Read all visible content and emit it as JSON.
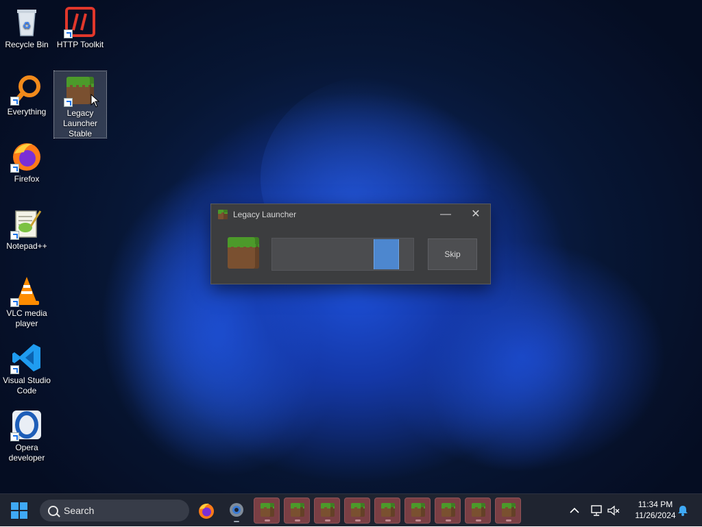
{
  "desktop": {
    "icons": [
      {
        "label": "Recycle Bin",
        "icon": "recycle-bin-icon"
      },
      {
        "label": "HTTP Toolkit",
        "icon": "http-toolkit-icon"
      },
      {
        "label": "Everything",
        "icon": "everything-search-icon"
      },
      {
        "label": "Legacy Launcher Stable",
        "icon": "grass-block-icon"
      },
      {
        "label": "Firefox",
        "icon": "firefox-icon"
      },
      {
        "label": "Notepad++",
        "icon": "notepad-plus-plus-icon"
      },
      {
        "label": "VLC media player",
        "icon": "vlc-cone-icon"
      },
      {
        "label": "Visual Studio Code",
        "icon": "vscode-icon"
      },
      {
        "label": "Opera developer",
        "icon": "opera-icon"
      }
    ]
  },
  "launcher_window": {
    "title": "Legacy Launcher",
    "skip_label": "Skip",
    "progress_segment": [
      0.72,
      0.89
    ],
    "accent_color": "#4d87cf"
  },
  "taskbar": {
    "search_label": "Search",
    "time": "11:34 PM",
    "date": "11/26/2024",
    "launcher_instances": 9,
    "color": "#1f2430"
  }
}
